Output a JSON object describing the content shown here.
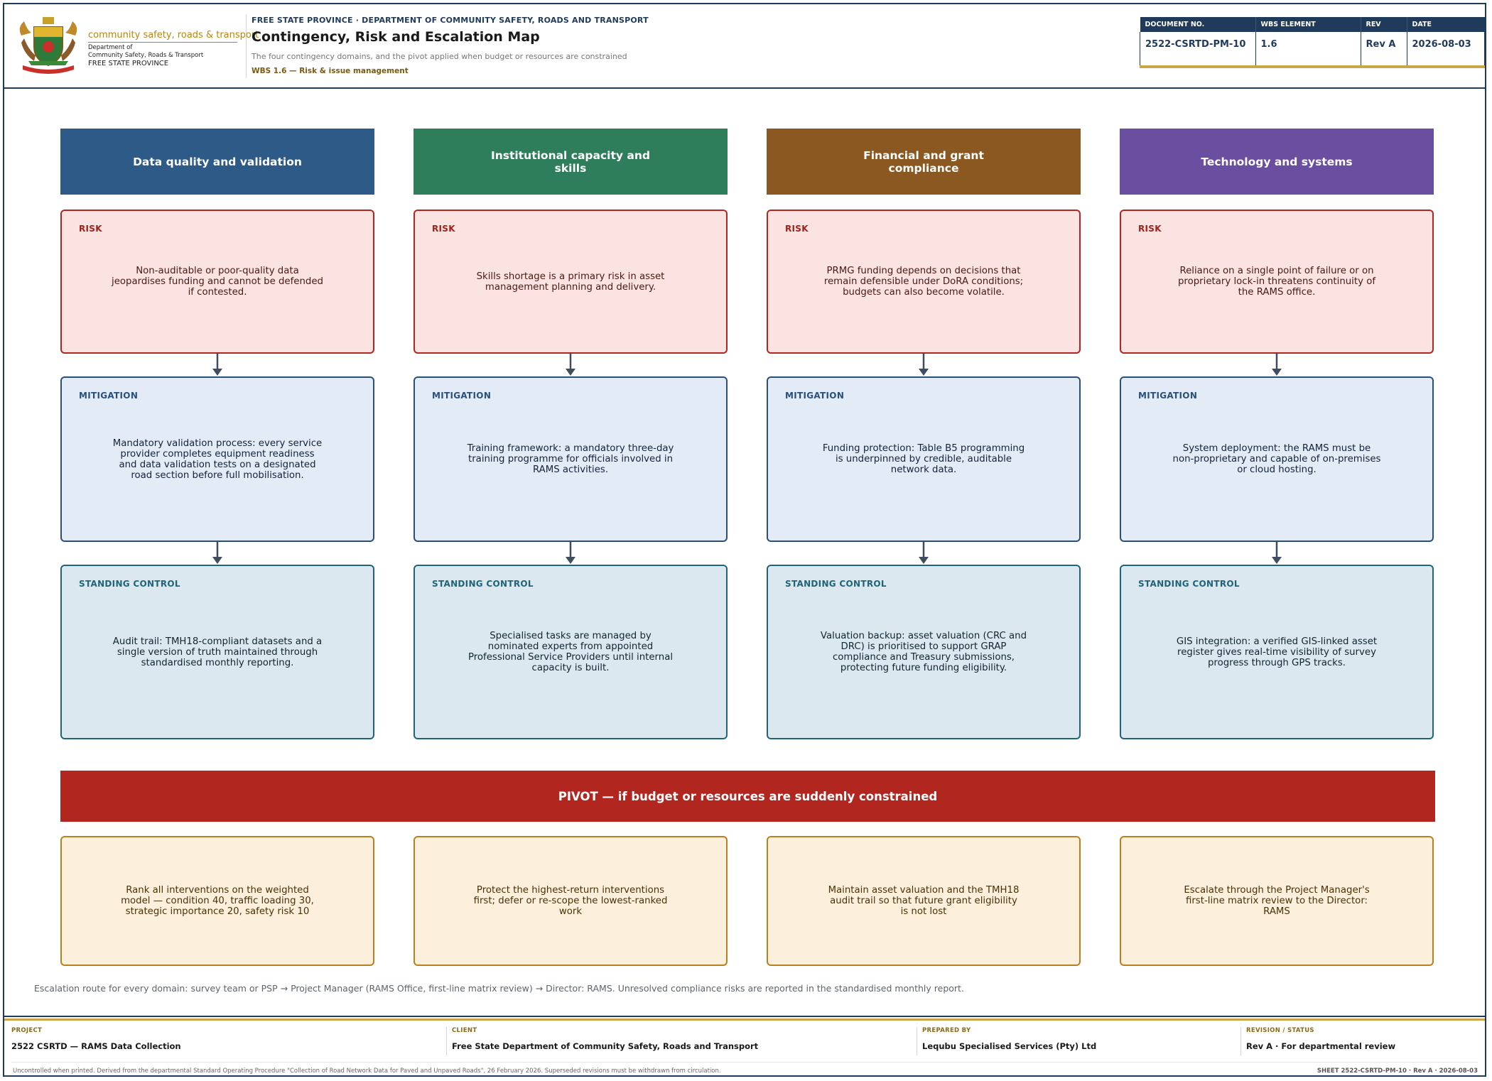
{
  "header": {
    "logo": {
      "line1": "community safety, roads & transport",
      "line2": "Department of",
      "line3": "Community Safety, Roads & Transport",
      "line4": "FREE STATE PROVINCE"
    },
    "kicker": "FREE STATE PROVINCE · DEPARTMENT OF COMMUNITY SAFETY, ROADS AND TRANSPORT",
    "title": "Contingency, Risk and Escalation Map",
    "subtitle": "The four contingency domains, and the pivot applied when budget or resources are constrained",
    "wbs": "WBS 1.6 — Risk & issue management"
  },
  "doc_block": {
    "headers": [
      "DOCUMENT NO.",
      "WBS ELEMENT",
      "REV",
      "DATE"
    ],
    "values": [
      "2522-CSRTD-PM-10",
      "1.6",
      "Rev A",
      "2026-08-03"
    ]
  },
  "labels": {
    "risk": "RISK",
    "mitigation": "MITIGATION",
    "standing": "STANDING CONTROL"
  },
  "domains": [
    {
      "title": "Data quality and validation",
      "color": "#2d5a87",
      "risk": "Non-auditable or poor-quality data jeopardises funding and cannot be defended if contested.",
      "mitigation": "Mandatory validation process: every service provider completes equipment readiness and data validation tests on a designated road section before full mobilisation.",
      "standing": "Audit trail: TMH18-compliant datasets and a single version of truth maintained through standardised monthly reporting."
    },
    {
      "title": "Institutional capacity and skills",
      "color": "#2e7d5b",
      "risk": "Skills shortage is a primary risk in asset management planning and delivery.",
      "mitigation": "Training framework: a mandatory three-day training programme for officials involved in RAMS activities.",
      "standing": "Specialised tasks are managed by nominated experts from appointed Professional Service Providers until internal capacity is built."
    },
    {
      "title": "Financial and grant compliance",
      "color": "#8a5820",
      "risk": "PRMG funding depends on decisions that remain defensible under DoRA conditions; budgets can also become volatile.",
      "mitigation": "Funding protection: Table B5 programming is underpinned by credible, auditable network data.",
      "standing": "Valuation backup: asset valuation (CRC and DRC) is prioritised to support GRAP compliance and Treasury submissions, protecting future funding eligibility."
    },
    {
      "title": "Technology and systems",
      "color": "#6a4fa0",
      "risk": "Reliance on a single point of failure or on proprietary lock-in threatens continuity of the RAMS office.",
      "mitigation": "System deployment: the RAMS must be non-proprietary and capable of on-premises or cloud hosting.",
      "standing": "GIS integration: a verified GIS-linked asset register gives real-time visibility of survey progress through GPS tracks."
    }
  ],
  "pivot": {
    "title": "PIVOT — if budget or resources are suddenly constrained",
    "color": "#b22620",
    "actions": [
      "Rank all interventions on the weighted model — condition 40, traffic loading 30, strategic importance 20, safety risk 10",
      "Protect the highest-return interventions first; defer or re-scope the lowest-ranked work",
      "Maintain asset valuation and the TMH18 audit trail so that future grant eligibility is not lost",
      "Escalate through the Project Manager's first-line matrix review to the Director: RAMS"
    ]
  },
  "escalation": "Escalation route for every domain: survey team or PSP → Project Manager (RAMS Office, first-line matrix review) → Director: RAMS. Unresolved compliance risks are reported in the standardised monthly report.",
  "footer": {
    "project_label": "PROJECT",
    "project": "2522 CSRTD — RAMS Data Collection",
    "client_label": "CLIENT",
    "client": "Free State Department of Community Safety, Roads and Transport",
    "prepared_label": "PREPARED BY",
    "prepared": "Lequbu Specialised Services (Pty) Ltd",
    "revision_label": "REVISION / STATUS",
    "revision": "Rev A · For departmental review",
    "note": "Uncontrolled when printed. Derived from the departmental Standard Operating Procedure \"Collection of Road Network Data for Paved and Unpaved Roads\", 26 February 2026. Superseded revisions must be withdrawn from circulation.",
    "sheet": "SHEET 2522-CSRTD-PM-10  ·  Rev A  ·  2026-08-03"
  }
}
